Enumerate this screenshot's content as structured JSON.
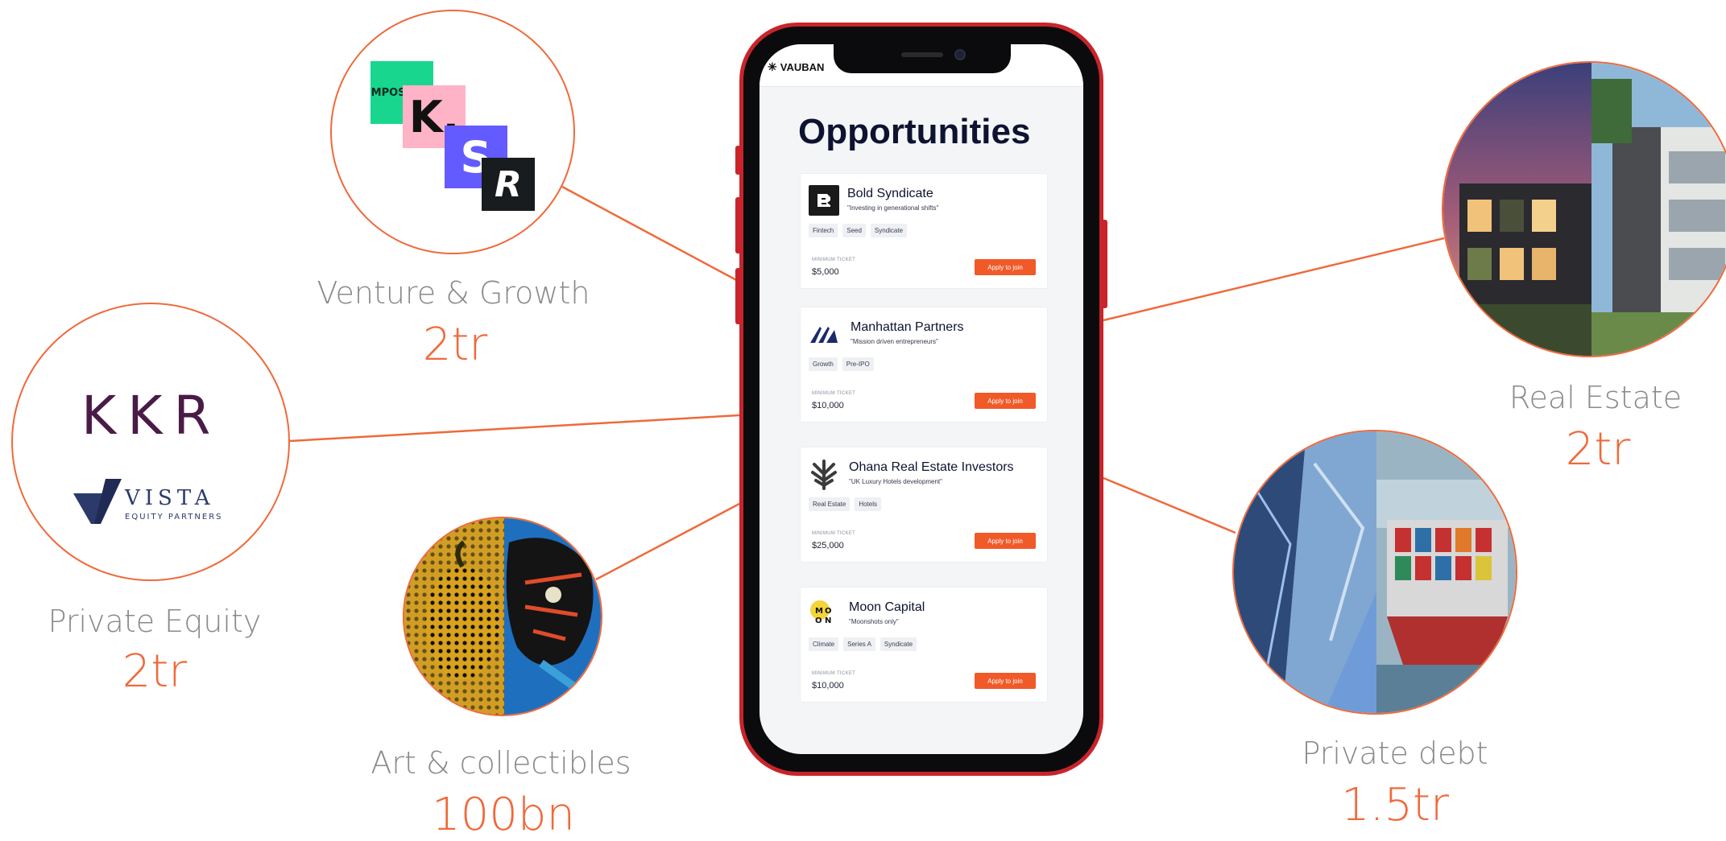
{
  "colors": {
    "accent": "#f0693a",
    "label_gray": "#8a8a8a",
    "phone_frame": "#c9242b",
    "apply_button": "#f05a28"
  },
  "categories": {
    "venture": {
      "label": "Venture & Growth",
      "value": "2tr",
      "logos": [
        "IMPOSSIBLE",
        "K.",
        "S",
        "R"
      ]
    },
    "private_equity": {
      "label": "Private Equity",
      "value": "2tr",
      "logos": {
        "kkr": "KKR",
        "vista_name": "VISTA",
        "vista_sub": "EQUITY PARTNERS"
      }
    },
    "art": {
      "label": "Art & collectibles",
      "value": "100bn"
    },
    "real_estate": {
      "label": "Real Estate",
      "value": "2tr"
    },
    "private_debt": {
      "label": "Private debt",
      "value": "1.5tr"
    }
  },
  "app": {
    "brand": "VAUBAN",
    "title": "Opportunities",
    "min_ticket_label": "MINIMUM TICKET",
    "apply_label": "Apply to join",
    "cards": [
      {
        "name": "Bold Syndicate",
        "tagline": "\"Investing in generational shifts\"",
        "tags": [
          "Fintech",
          "Seed",
          "Syndicate"
        ],
        "min_ticket": "$5,000"
      },
      {
        "name": "Manhattan Partners",
        "tagline": "\"Mission driven entrepreneurs\"",
        "tags": [
          "Growth",
          "Pre-IPO"
        ],
        "min_ticket": "$10,000"
      },
      {
        "name": "Ohana Real Estate Investors",
        "tagline": "\"UK Luxury Hotels development\"",
        "tags": [
          "Real Estate",
          "Hotels"
        ],
        "min_ticket": "$25,000"
      },
      {
        "name": "Moon Capital",
        "tagline": "\"Moonshots only\"",
        "tags": [
          "Climate",
          "Series A",
          "Syndicate"
        ],
        "min_ticket": "$10,000"
      }
    ]
  }
}
